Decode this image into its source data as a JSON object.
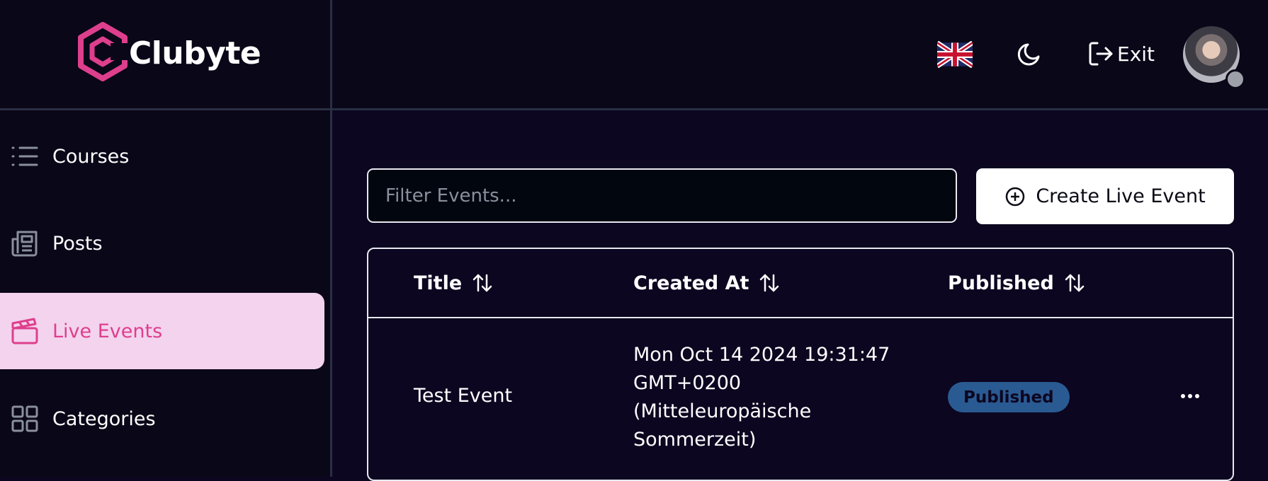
{
  "brand": {
    "name": "Clubyte"
  },
  "colors": {
    "accent": "#de3f8d",
    "active_bg": "#f3d3ee",
    "badge_bg": "#2a5a92"
  },
  "header": {
    "language_icon": "uk-flag-icon",
    "theme_icon": "moon-icon",
    "exit_label": "Exit"
  },
  "sidebar": {
    "items": [
      {
        "label": "Courses",
        "icon": "list-icon",
        "active": false
      },
      {
        "label": "Posts",
        "icon": "newspaper-icon",
        "active": false
      },
      {
        "label": "Live Events",
        "icon": "clapperboard-icon",
        "active": true
      },
      {
        "label": "Categories",
        "icon": "grid-icon",
        "active": false
      }
    ]
  },
  "main": {
    "filter_placeholder": "Filter Events...",
    "create_label": "Create Live Event",
    "table": {
      "columns": [
        "Title",
        "Created At",
        "Published"
      ],
      "rows": [
        {
          "title": "Test Event",
          "created_at_lines": [
            "Mon Oct 14 2024 19:31:47",
            "GMT+0200",
            "(Mitteleuropäische",
            "Sommerzeit)"
          ],
          "published": "Published"
        }
      ]
    }
  }
}
